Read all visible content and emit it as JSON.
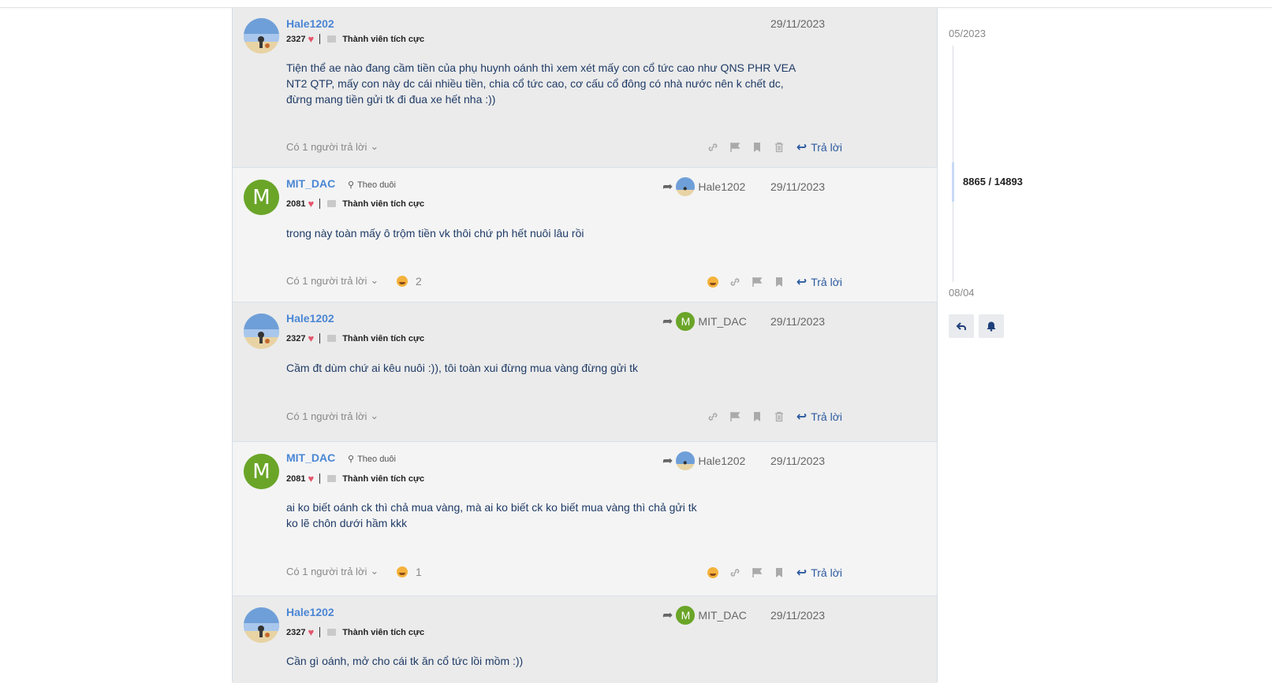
{
  "posts": [
    {
      "user": "Hale1202",
      "likes": "2327",
      "rank": "Thành viên tích cực",
      "date": "29/11/2023",
      "reply_to": "",
      "follow": "",
      "lines": [
        "Tiện thể ae nào đang cầm tiền của phụ huynh oánh thì xem xét mấy con cổ tức cao như QNS PHR VEA",
        "NT2 QTP, mấy con này dc cái nhiều tiền, chia cổ tức cao, cơ cấu cổ đông có nhà nước nên k chết dc,",
        "đừng mang tiền gửi tk đi đua xe hết nha :))"
      ],
      "replies_label": "Có 1 người trả lời",
      "reaction_count": "",
      "reply_label": "Trả lời"
    },
    {
      "user": "MIT_DAC",
      "likes": "2081",
      "rank": "Thành viên tích cực",
      "date": "29/11/2023",
      "reply_to": "Hale1202",
      "follow": "Theo duôi",
      "lines": [
        "trong này toàn mấy ô trộm tiền vk thôi chứ ph hết nuôi lâu rồi"
      ],
      "replies_label": "Có 1 người trả lời",
      "reaction_count": "2",
      "reply_label": "Trả lời"
    },
    {
      "user": "Hale1202",
      "likes": "2327",
      "rank": "Thành viên tích cực",
      "date": "29/11/2023",
      "reply_to": "MIT_DAC",
      "follow": "",
      "lines": [
        "Cầm đt dùm chứ ai kêu nuôi :)), tôi toàn xui đừng mua vàng đừng gửi tk"
      ],
      "replies_label": "Có 1 người trả lời",
      "reaction_count": "",
      "reply_label": "Trả lời"
    },
    {
      "user": "MIT_DAC",
      "likes": "2081",
      "rank": "Thành viên tích cực",
      "date": "29/11/2023",
      "reply_to": "Hale1202",
      "follow": "Theo duôi",
      "lines": [
        "ai ko biết oánh ck thì chả mua vàng, mà ai ko biết ck ko biết mua vàng thì chả gửi tk",
        "ko lẽ chôn dưới hầm kkk"
      ],
      "replies_label": "Có 1 người trả lời",
      "reaction_count": "1",
      "reply_label": "Trả lời"
    },
    {
      "user": "Hale1202",
      "likes": "2327",
      "rank": "Thành viên tích cực",
      "date": "29/11/2023",
      "reply_to": "MIT_DAC",
      "follow": "",
      "lines": [
        "Cần gì oánh, mở cho cái tk ăn cổ tức lồi mồm :))"
      ],
      "replies_label": "",
      "reaction_count": "",
      "reply_label": ""
    }
  ],
  "timeline": {
    "start": "05/2023",
    "position": "8865 / 14893",
    "end": "08/04"
  },
  "colors": {
    "accent": "#4a86d4",
    "link": "#2c5aa0",
    "heart": "#e4556b",
    "avatar_m": "#6aa528"
  }
}
